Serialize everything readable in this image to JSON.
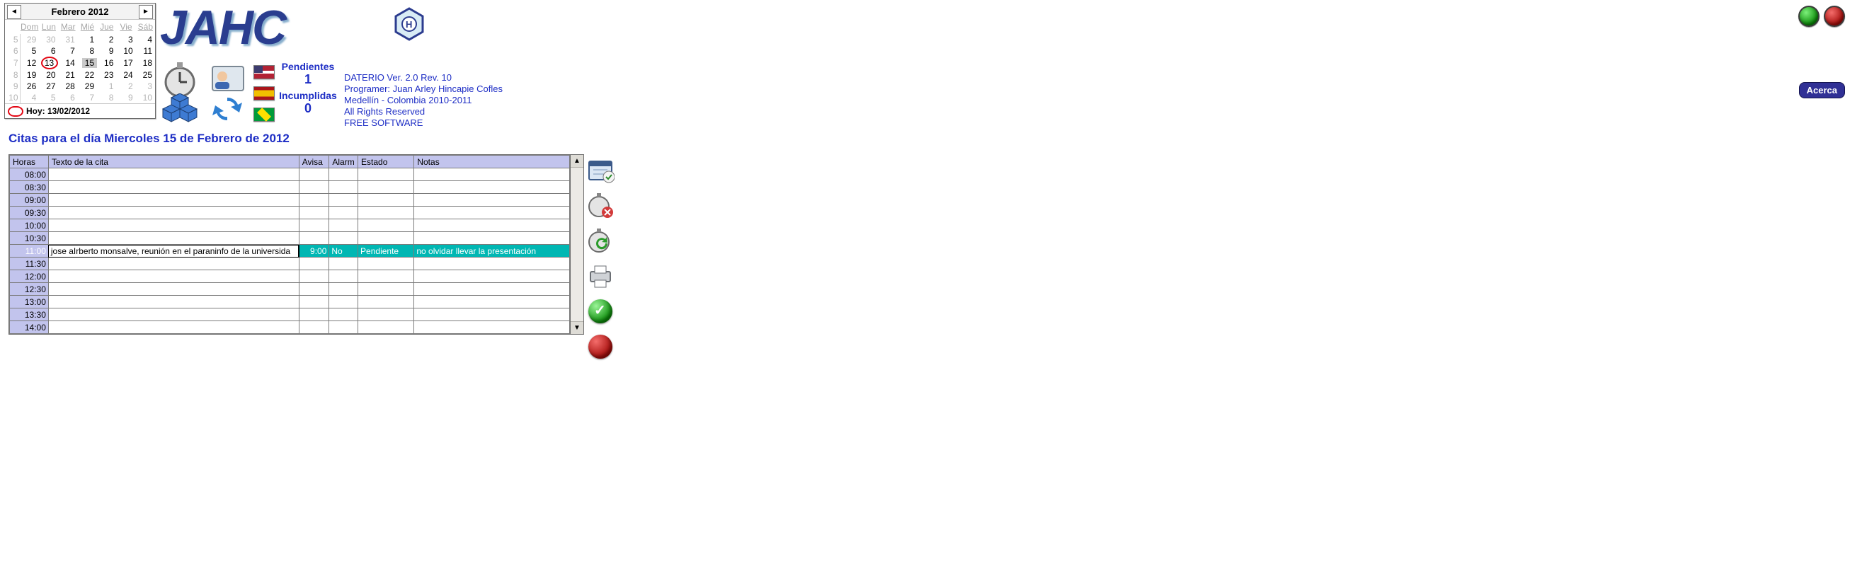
{
  "calendar": {
    "title": "Febrero 2012",
    "dow": [
      "Dom",
      "Lun",
      "Mar",
      "Mié",
      "Jue",
      "Vie",
      "Sáb"
    ],
    "weeks": [
      {
        "wk": "5",
        "days": [
          {
            "n": "29",
            "other": true
          },
          {
            "n": "30",
            "other": true
          },
          {
            "n": "31",
            "other": true
          },
          {
            "n": "1"
          },
          {
            "n": "2"
          },
          {
            "n": "3"
          },
          {
            "n": "4"
          }
        ]
      },
      {
        "wk": "6",
        "days": [
          {
            "n": "5"
          },
          {
            "n": "6"
          },
          {
            "n": "7"
          },
          {
            "n": "8"
          },
          {
            "n": "9"
          },
          {
            "n": "10"
          },
          {
            "n": "11"
          }
        ]
      },
      {
        "wk": "7",
        "days": [
          {
            "n": "12"
          },
          {
            "n": "13",
            "today": true
          },
          {
            "n": "14"
          },
          {
            "n": "15",
            "selected": true
          },
          {
            "n": "16"
          },
          {
            "n": "17"
          },
          {
            "n": "18"
          }
        ]
      },
      {
        "wk": "8",
        "days": [
          {
            "n": "19"
          },
          {
            "n": "20"
          },
          {
            "n": "21"
          },
          {
            "n": "22"
          },
          {
            "n": "23"
          },
          {
            "n": "24"
          },
          {
            "n": "25"
          }
        ]
      },
      {
        "wk": "9",
        "days": [
          {
            "n": "26"
          },
          {
            "n": "27"
          },
          {
            "n": "28"
          },
          {
            "n": "29"
          },
          {
            "n": "1",
            "other": true
          },
          {
            "n": "2",
            "other": true
          },
          {
            "n": "3",
            "other": true
          }
        ]
      },
      {
        "wk": "10",
        "days": [
          {
            "n": "4",
            "other": true
          },
          {
            "n": "5",
            "other": true
          },
          {
            "n": "6",
            "other": true
          },
          {
            "n": "7",
            "other": true
          },
          {
            "n": "8",
            "other": true
          },
          {
            "n": "9",
            "other": true
          },
          {
            "n": "10",
            "other": true
          }
        ]
      }
    ],
    "today_label": "Hoy: 13/02/2012"
  },
  "brand_text": "JAHC",
  "counters": {
    "pending_label": "Pendientes",
    "pending_value": "1",
    "missed_label": "Incumplidas",
    "missed_value": "0"
  },
  "appinfo": {
    "l1": "DATERIO Ver. 2.0 Rev. 10",
    "l2": "Programer: Juan Arley Hincapie Cofles",
    "l3": "Medellín - Colombia 2010-2011",
    "l4": "All Rights Reserved",
    "l5": "FREE SOFTWARE"
  },
  "about_btn": "Acerca",
  "day_title": "Citas para el día Miercoles 15 de Febrero de 2012",
  "grid": {
    "columns": [
      "Horas",
      "Texto de la cita",
      "Avisa",
      "Alarm",
      "Estado",
      "Notas"
    ],
    "rows": [
      {
        "hour": "08:00"
      },
      {
        "hour": "08:30"
      },
      {
        "hour": "09:00"
      },
      {
        "hour": "09:30"
      },
      {
        "hour": "10:00"
      },
      {
        "hour": "10:30"
      },
      {
        "hour": "11:00",
        "text": "jose aIrberto monsalve, reunión en el paraninfo de la universida",
        "avisa": "9:00",
        "alarm": "No",
        "estado": "Pendiente",
        "notas": "no olvidar llevar la presentación",
        "selected": true,
        "editing": true
      },
      {
        "hour": "11:30"
      },
      {
        "hour": "12:00"
      },
      {
        "hour": "12:30"
      },
      {
        "hour": "13:00"
      },
      {
        "hour": "13:30"
      },
      {
        "hour": "14:00"
      }
    ]
  },
  "flags": {
    "us_name": "flag-us",
    "es_name": "flag-es",
    "br_name": "flag-br"
  },
  "tool_names": {
    "calendar": "calendar-add-icon",
    "cancel": "stopwatch-cancel-icon",
    "refresh": "stopwatch-refresh-icon",
    "print": "printer-icon",
    "ok": "ok-icon",
    "stop": "stop-icon"
  }
}
